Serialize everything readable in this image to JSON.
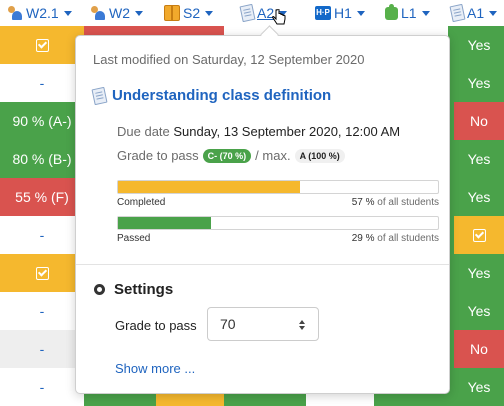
{
  "header": {
    "columns": [
      {
        "label": "W2.1",
        "icon": "group-icon"
      },
      {
        "label": "W2",
        "icon": "group-icon"
      },
      {
        "label": "S2",
        "icon": "box-icon"
      },
      {
        "label": "A2",
        "icon": "assignment-icon",
        "active": true
      },
      {
        "label": "H1",
        "icon": "h5p-icon"
      },
      {
        "label": "L1",
        "icon": "puzzle-icon"
      },
      {
        "label": "A1",
        "icon": "assignment-icon"
      }
    ]
  },
  "grid": {
    "col1": [
      "✔",
      "-",
      "90 % (A-)",
      "80 % (B-)",
      "55 % (F)",
      "-",
      "✔",
      "-",
      "-",
      "-"
    ],
    "col7": [
      "Yes",
      "Yes",
      "No",
      "Yes",
      "Yes",
      "✔",
      "Yes",
      "Yes",
      "No",
      "Yes"
    ]
  },
  "popover": {
    "last_modified": "Last modified on Saturday, 12 September 2020",
    "title": "Understanding class definition",
    "due_label": "Due date",
    "due_value": "Sunday, 13 September 2020, 12:00 AM",
    "grade_label": "Grade to pass",
    "grade_badge": "C- (70 %)",
    "max_label": "/ max.",
    "max_badge": "A (100 %)",
    "completed": {
      "label": "Completed",
      "percent": 57,
      "percent_text": "57 %",
      "suffix": "of all students",
      "color": "#f5b82e"
    },
    "passed": {
      "label": "Passed",
      "percent": 29,
      "percent_text": "29 %",
      "suffix": "of all students",
      "color": "#4aa24a"
    },
    "settings_title": "Settings",
    "settings_grade_label": "Grade to pass",
    "settings_grade_value": "70",
    "show_more": "Show more ..."
  }
}
